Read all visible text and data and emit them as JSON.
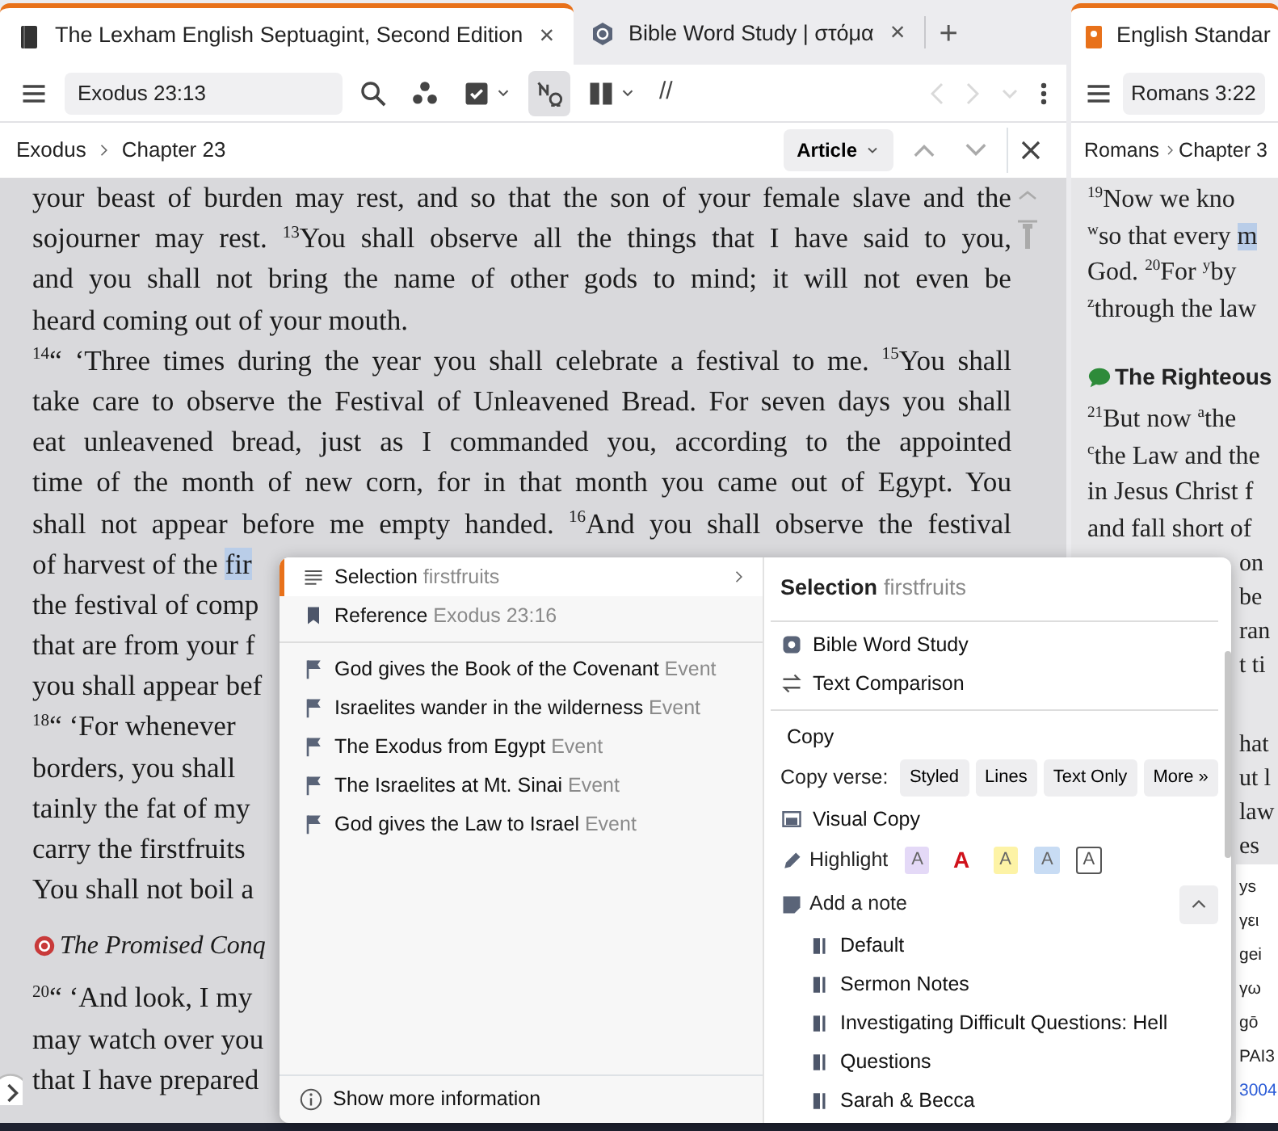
{
  "left_pane": {
    "tabs": [
      {
        "kind": "resource",
        "title": "The Lexham English Septuagint, Second Edition",
        "close": "×",
        "selected": true
      },
      {
        "kind": "guide",
        "title": "Bible Word Study | στόμα",
        "close": "×",
        "selected": false
      }
    ],
    "new_tab": "+",
    "reference": "Exodus 23:13",
    "tools": [
      {
        "kind": "search",
        "selected": false,
        "dropdown": false
      },
      {
        "kind": "cluster",
        "selected": false,
        "dropdown": false
      },
      {
        "kind": "checkbook",
        "selected": false,
        "dropdown": true
      },
      {
        "kind": "interlinear",
        "selected": true,
        "dropdown": false
      },
      {
        "kind": "parallel",
        "selected": false,
        "dropdown": true
      },
      {
        "kind": "text",
        "label": "//",
        "selected": false,
        "dropdown": false
      }
    ],
    "nav": [
      {
        "kind": "back",
        "disabled": true
      },
      {
        "kind": "forward",
        "disabled": true
      },
      {
        "kind": "history",
        "disabled": true
      },
      {
        "kind": "more",
        "disabled": false
      }
    ],
    "breadcrumb": [
      "Exodus",
      "Chapter 23"
    ],
    "view_button": "Article",
    "blocks": [
      {
        "kind": "full",
        "text": "your beast of burden may rest, and so that the son of your female slave and the"
      },
      {
        "kind": "full",
        "text": "sojourner may rest. $^{13}$You shall observe all the things that I have said to you,"
      },
      {
        "kind": "full",
        "text": "and you shall not bring the name of other gods to mind; it will not even be"
      },
      {
        "kind": "end",
        "text": "heard coming out of your mouth."
      },
      {
        "kind": "full",
        "text": " $^{14}$“ ‘Three times during the year you shall celebrate a festival to me. $^{15}$You shall"
      },
      {
        "kind": "full",
        "text": "take care to observe the Festival of Unleavened Bread. For seven days you shall"
      },
      {
        "kind": "full",
        "text": "eat unleavened bread, just as I commanded you, according to the appointed"
      },
      {
        "kind": "full",
        "text": "time of the month of new corn, for in that month you came out of Egypt. You"
      },
      {
        "kind": "full",
        "text": "shall not appear before me empty handed. $^{16}$And you shall observe the festival"
      },
      {
        "kind": "end",
        "text": "of harvest of the ",
        "selection": "fir"
      },
      {
        "kind": "end",
        "text": "the festival of comp"
      },
      {
        "kind": "end",
        "text": "that are from your f"
      },
      {
        "kind": "end",
        "text": "you shall appear bef"
      },
      {
        "kind": "end",
        "text": " $^{18}$“ ‘For whenever"
      },
      {
        "kind": "end",
        "text": "borders, you shall"
      },
      {
        "kind": "end",
        "text": "tainly the fat of my"
      },
      {
        "kind": "end",
        "text": "carry the firstfruits"
      },
      {
        "kind": "end",
        "text": "You shall not boil a"
      },
      {
        "kind": "heading",
        "text": "The Promised Conq"
      },
      {
        "kind": "end",
        "text": " $^{20}$“ ‘And look, I my"
      },
      {
        "kind": "end",
        "text": "may watch over you"
      },
      {
        "kind": "end",
        "text": "that I have prepared"
      }
    ]
  },
  "right_pane": {
    "tab": {
      "kind": "resource",
      "title": "English Standar"
    },
    "reference": "Romans 3:22",
    "breadcrumb": [
      "Romans",
      "Chapter 3"
    ],
    "blocks": [
      {
        "kind": "end",
        "text": " $^{19}$Now we kno"
      },
      {
        "kind": "end",
        "text": "$^{w}$so that every ",
        "selection": "m"
      },
      {
        "kind": "end",
        "text": "God.  $^{20}$For $^{y}$by"
      },
      {
        "kind": "end",
        "text": "$^{z}$through the law"
      },
      {
        "kind": "heading",
        "text": "The Righteous"
      },
      {
        "kind": "end",
        "text": " $^{21}$But now $^{a}$the"
      },
      {
        "kind": "end",
        "text": "$^{c}$the Law and the"
      },
      {
        "kind": "end",
        "text": "in Jesus Christ f"
      },
      {
        "kind": "end",
        "text": "and fall short of"
      }
    ],
    "peek_groups": [
      [
        "on",
        "be",
        "ran",
        "t ti"
      ],
      [
        "hat",
        "ut l",
        "law",
        "es"
      ]
    ],
    "side_card": [
      {
        "kind": "plain",
        "text": "ys"
      },
      {
        "kind": "plain",
        "text": "γει"
      },
      {
        "kind": "plain",
        "text": "gei"
      },
      {
        "kind": "plain",
        "text": "γω"
      },
      {
        "kind": "plain",
        "text": "gō"
      },
      {
        "kind": "plain",
        "text": "PAI3"
      },
      {
        "kind": "link",
        "text": "3004"
      }
    ]
  },
  "context_menu": {
    "left": {
      "items": [
        {
          "kind": "selection",
          "label": "Selection",
          "detail": "firstfruits",
          "selected": true,
          "submenu": true
        },
        {
          "kind": "reference",
          "label": "Reference",
          "detail": "Exodus 23:16",
          "selected": false,
          "submenu": false
        }
      ],
      "events": [
        {
          "title": "God gives the Book of the Covenant",
          "type": "Event"
        },
        {
          "title": "Israelites wander in the wilderness",
          "type": "Event"
        },
        {
          "title": "The Exodus from Egypt",
          "type": "Event"
        },
        {
          "title": "The Israelites at Mt. Sinai",
          "type": "Event"
        },
        {
          "title": "God gives the Law to Israel",
          "type": "Event"
        }
      ],
      "more": "Show more information"
    },
    "right": {
      "title": "Selection",
      "detail": "firstfruits",
      "actions": [
        {
          "kind": "word-study",
          "label": "Bible Word Study"
        },
        {
          "kind": "compare",
          "label": "Text Comparison"
        }
      ],
      "copy": "Copy",
      "copy_verse": {
        "label": "Copy verse:",
        "options": [
          "Styled",
          "Lines",
          "Text Only",
          "More »"
        ]
      },
      "visual_copy": "Visual Copy",
      "highlight": {
        "label": "Highlight",
        "styles": [
          {
            "kind": "fill",
            "label": "A",
            "color": "#e4d9f7"
          },
          {
            "kind": "bold",
            "label": "A",
            "color": "#d0121b"
          },
          {
            "kind": "fill",
            "label": "A",
            "color": "#fdf3a6"
          },
          {
            "kind": "fill",
            "label": "A",
            "color": "#c8dcf4"
          },
          {
            "kind": "boxed",
            "label": "A",
            "color": "#555555"
          }
        ]
      },
      "add_note": {
        "label": "Add a note",
        "expanded": true,
        "notebooks": [
          "Default",
          "Sermon Notes",
          "Investigating Difficult Questions: Hell",
          "Questions",
          "Sarah & Becca"
        ]
      }
    }
  }
}
